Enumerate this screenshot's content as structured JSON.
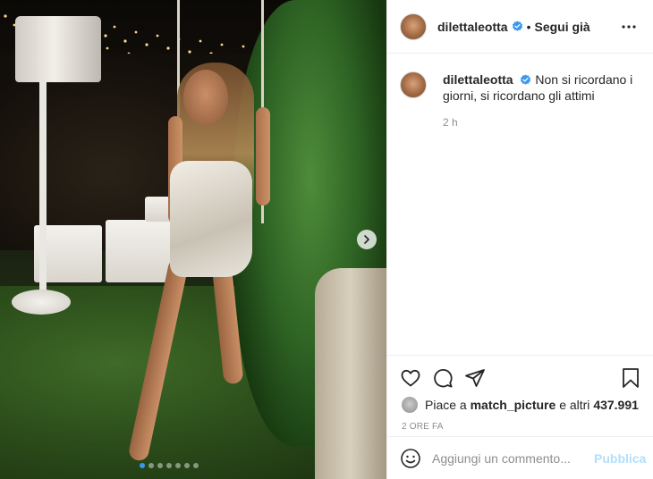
{
  "post": {
    "image_alt": "photo post",
    "carousel": {
      "dot_count": 7,
      "active_index": 0,
      "next_icon": "chevron-right-icon"
    }
  },
  "header": {
    "username": "dilettaleotta",
    "verified_icon": "verified-badge-icon",
    "bullet": "•",
    "follow_label": "Segui già",
    "more_label": "•••",
    "more_icon": "more-options-icon"
  },
  "caption": {
    "username": "dilettaleotta",
    "text": "Non si ricordano i giorni, si ricordano gli attimi",
    "time": "2 h"
  },
  "actions": {
    "like_icon": "heart-icon",
    "comment_icon": "comment-icon",
    "share_icon": "share-icon",
    "save_icon": "bookmark-icon"
  },
  "likes": {
    "prefix": "Piace a ",
    "user": "match_picture",
    "middle": " e altri ",
    "count": "437.991"
  },
  "posted_ago": "2 ORE FA",
  "comment": {
    "emoji_icon": "emoji-icon",
    "placeholder": "Aggiungi un commento...",
    "publish_label": "Pubblica"
  },
  "colors": {
    "verified": "#3897f0",
    "publish_disabled": "#b2dffc",
    "secondary_text": "#8e8e8e"
  }
}
